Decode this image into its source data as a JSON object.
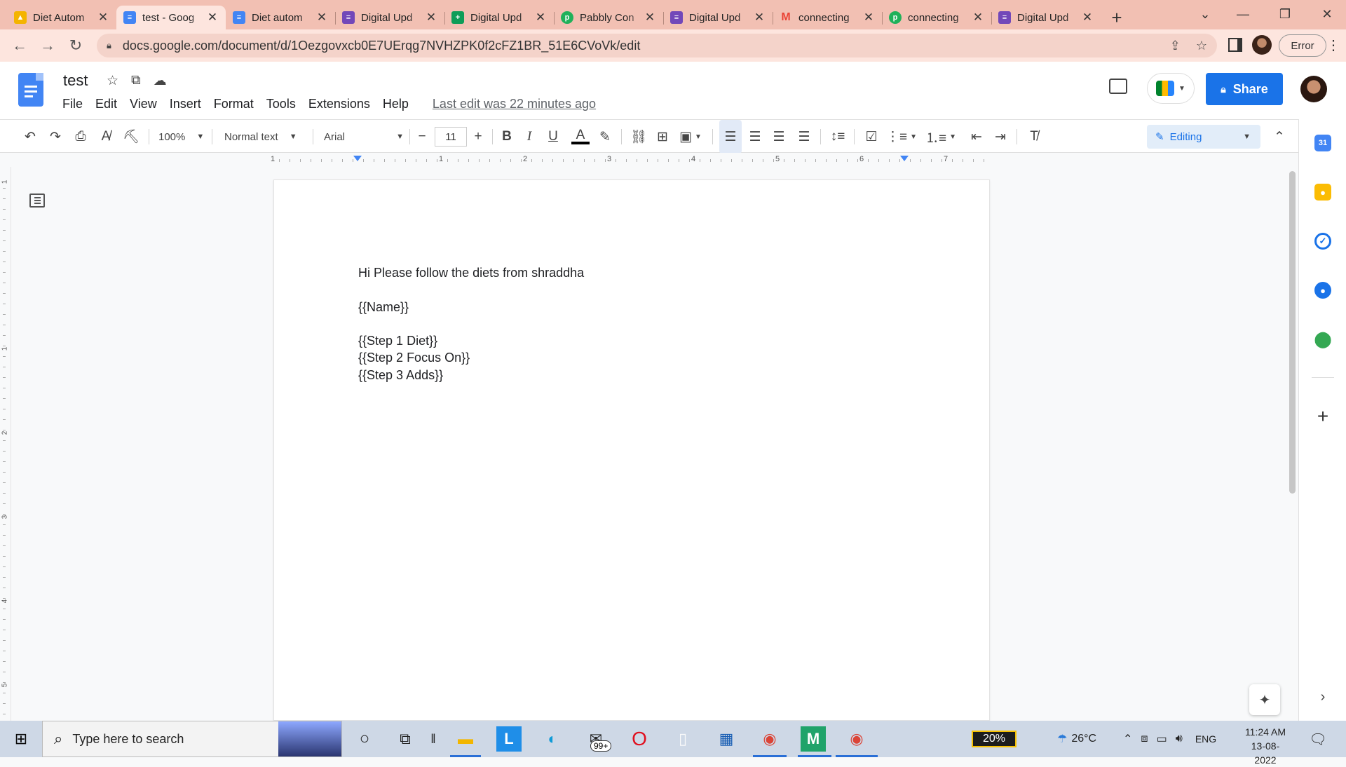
{
  "browser": {
    "tabs": [
      {
        "title": "Diet Autom",
        "icon": "google-drive-icon",
        "color": "#f4b400",
        "active": false
      },
      {
        "title": "test - Goog",
        "icon": "google-docs-icon",
        "color": "#4285f4",
        "active": true
      },
      {
        "title": "Diet autom",
        "icon": "google-docs-icon",
        "color": "#4285f4",
        "active": false
      },
      {
        "title": "Digital Upd",
        "icon": "google-forms-icon",
        "color": "#7248b9",
        "active": false
      },
      {
        "title": "Digital Upd",
        "icon": "google-sheets-icon",
        "color": "#0f9d58",
        "active": false
      },
      {
        "title": "Pabbly Con",
        "icon": "pabbly-icon",
        "color": "#20b15a",
        "active": false
      },
      {
        "title": "Digital Upd",
        "icon": "google-forms-icon",
        "color": "#7248b9",
        "active": false
      },
      {
        "title": "connecting",
        "icon": "gmail-icon",
        "color": "#ea4335",
        "active": false
      },
      {
        "title": "connecting",
        "icon": "pabbly-icon",
        "color": "#20b15a",
        "active": false
      },
      {
        "title": "Digital Upd",
        "icon": "google-forms-icon",
        "color": "#7248b9",
        "active": false
      }
    ],
    "url": "docs.google.com/document/d/1Oezgovxcb0E7UErqg7NVHZPK0f2cFZ1BR_51E6CVoVk/edit",
    "error_label": "Error"
  },
  "doc": {
    "title": "test",
    "menu": [
      "File",
      "Edit",
      "View",
      "Insert",
      "Format",
      "Tools",
      "Extensions",
      "Help"
    ],
    "last_edit": "Last edit was 22 minutes ago",
    "share_label": "Share",
    "toolbar": {
      "zoom": "100%",
      "style": "Normal text",
      "font": "Arial",
      "font_size": "11",
      "mode": "Editing"
    },
    "ruler_labels": [
      "1",
      "1",
      "2",
      "3",
      "4",
      "5",
      "6",
      "7"
    ],
    "vruler_labels": [
      "1",
      "1",
      "2",
      "3",
      "4",
      "5"
    ],
    "body": [
      "Hi Please follow the diets from shraddha",
      "{{Name}}",
      "{{Step 1 Diet}}",
      "{{Step 2 Focus On}}",
      "{{Step 3 Adds}}"
    ]
  },
  "taskbar": {
    "search_placeholder": "Type here to search",
    "badge_count": "99+",
    "battery": "20%",
    "temperature": "26°C",
    "language": "ENG",
    "time": "11:24 AM",
    "date": "13-08-2022"
  }
}
